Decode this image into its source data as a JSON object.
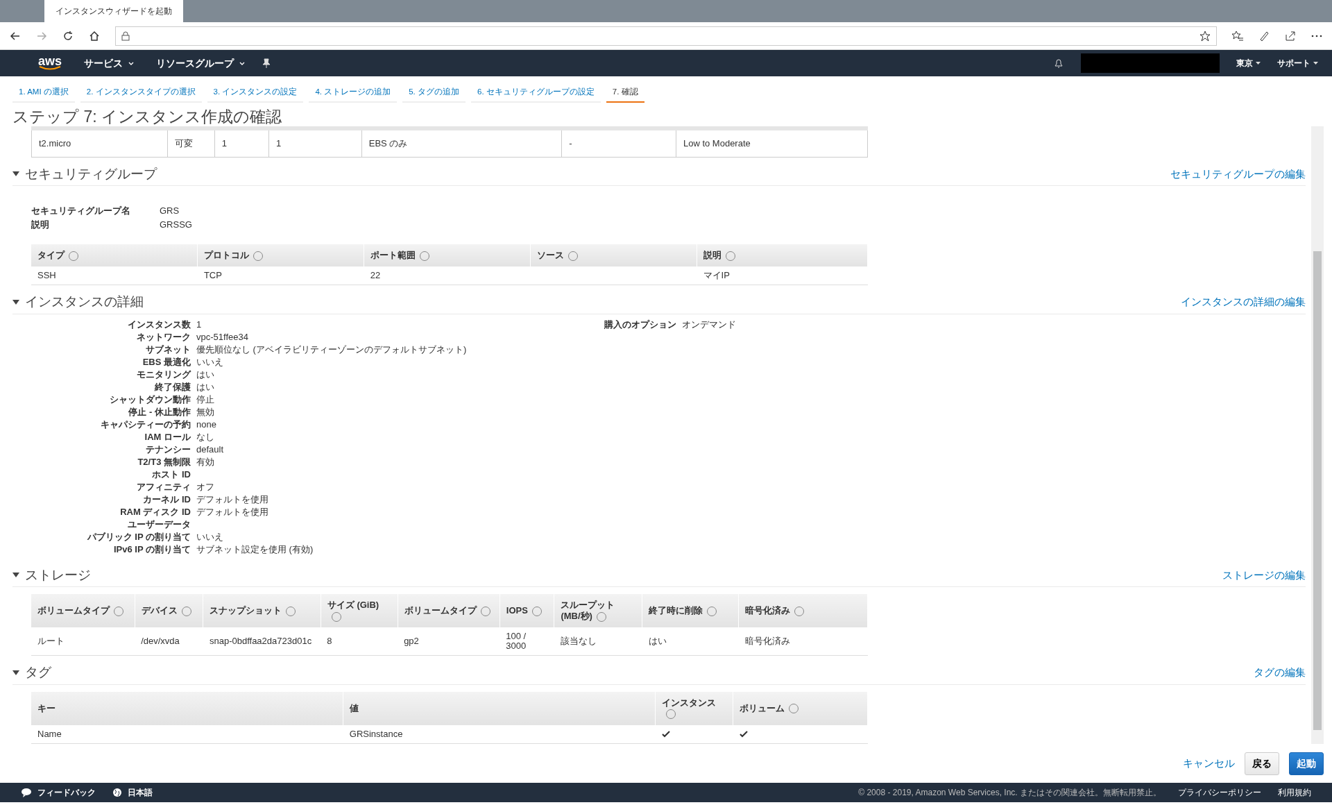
{
  "browser": {
    "tab_title": "インスタンスウィザードを起動"
  },
  "nav": {
    "logo": "aws",
    "menus": [
      "サービス",
      "リソースグループ"
    ],
    "region": "東京",
    "support": "サポート"
  },
  "wizard_tabs": [
    {
      "label": "1. AMI の選択",
      "selected": false
    },
    {
      "label": "2. インスタンスタイプの選択",
      "selected": false
    },
    {
      "label": "3. インスタンスの設定",
      "selected": false
    },
    {
      "label": "4. ストレージの追加",
      "selected": false
    },
    {
      "label": "5. タグの追加",
      "selected": false
    },
    {
      "label": "6. セキュリティグループの設定",
      "selected": false
    },
    {
      "label": "7. 確認",
      "selected": true
    }
  ],
  "title": "ステップ 7: インスタンス作成の確認",
  "instance_type_row": [
    "t2.micro",
    "可変",
    "1",
    "1",
    "EBS のみ",
    "-",
    "Low to Moderate"
  ],
  "security_group": {
    "title": "セキュリティグループ",
    "expanded": true,
    "edit_link": "セキュリティグループの編集",
    "fields": [
      {
        "label": "セキュリティグループ名",
        "value": "GRS"
      },
      {
        "label": "説明",
        "value": "GRSSG"
      }
    ],
    "columns": [
      {
        "label": "タイプ",
        "info": true
      },
      {
        "label": "プロトコル",
        "info": true
      },
      {
        "label": "ポート範囲",
        "info": true
      },
      {
        "label": "ソース",
        "info": true
      },
      {
        "label": "説明",
        "info": true
      }
    ],
    "rows": [
      [
        "SSH",
        "TCP",
        "22",
        "",
        "マイIP"
      ]
    ]
  },
  "instance_details": {
    "title": "インスタンスの詳細",
    "expanded": true,
    "edit_link": "インスタンスの詳細の編集",
    "fields": [
      {
        "label": "インスタンス数",
        "value": "1"
      },
      {
        "label": "ネットワーク",
        "value": "vpc-51ffee34"
      },
      {
        "label": "サブネット",
        "value": "優先順位なし (アベイラビリティーゾーンのデフォルトサブネット)"
      },
      {
        "label": "EBS 最適化",
        "value": "いいえ"
      },
      {
        "label": "モニタリング",
        "value": "はい"
      },
      {
        "label": "終了保護",
        "value": "はい"
      },
      {
        "label": "シャットダウン動作",
        "value": "停止"
      },
      {
        "label": "停止 - 休止動作",
        "value": "無効"
      },
      {
        "label": "キャパシティーの予約",
        "value": "none"
      },
      {
        "label": "IAM ロール",
        "value": "なし"
      },
      {
        "label": "テナンシー",
        "value": "default"
      },
      {
        "label": "T2/T3 無制限",
        "value": "有効"
      },
      {
        "label": "ホスト ID"
      },
      {
        "label": "アフィニティ",
        "value": "オフ"
      },
      {
        "label": "カーネル ID",
        "value": "デフォルトを使用"
      },
      {
        "label": "RAM ディスク ID",
        "value": "デフォルトを使用"
      },
      {
        "label": "ユーザーデータ"
      },
      {
        "label": "パブリック IP の割り当て",
        "value": "いいえ"
      },
      {
        "label": "IPv6 IP の割り当て",
        "value": "サブネット設定を使用 (有効)"
      }
    ],
    "side_fields": [
      {
        "label": "購入のオプション",
        "value": "オンデマンド"
      }
    ]
  },
  "storage": {
    "title": "ストレージ",
    "expanded": true,
    "edit_link": "ストレージの編集",
    "columns": [
      {
        "label": "ボリュームタイプ",
        "info": true
      },
      {
        "label": "デバイス",
        "info": true
      },
      {
        "label": "スナップショット",
        "info": true
      },
      {
        "label": "サイズ (GiB)",
        "info": true
      },
      {
        "label": "ボリュームタイプ",
        "info": true
      },
      {
        "label": "IOPS",
        "info": true
      },
      {
        "label": "スループット (MB/秒)",
        "info": true
      },
      {
        "label": "終了時に削除",
        "info": true
      },
      {
        "label": "暗号化済み",
        "info": true
      }
    ],
    "rows": [
      [
        "ルート",
        "/dev/xvda",
        "snap-0bdffaa2da723d01c",
        "8",
        "gp2",
        "100 / 3000",
        "該当なし",
        "はい",
        "暗号化済み"
      ]
    ]
  },
  "tags": {
    "title": "タグ",
    "expanded": true,
    "edit_link": "タグの編集",
    "columns": [
      {
        "label": "キー",
        "info": false
      },
      {
        "label": "値",
        "info": false
      },
      {
        "label": "インスタンス",
        "info": true
      },
      {
        "label": "ボリューム",
        "info": true
      }
    ],
    "rows": [
      {
        "key": "Name",
        "value": "GRSinstance",
        "instance": true,
        "volume": true
      }
    ]
  },
  "buttons": {
    "cancel": "キャンセル",
    "back": "戻る",
    "launch": "起動"
  },
  "footer": {
    "feedback": "フィードバック",
    "language": "日本語",
    "copyright": "© 2008 - 2019, Amazon Web Services, Inc. またはその関連会社。無断転用禁止。",
    "privacy": "プライバシーポリシー",
    "terms": "利用規約"
  }
}
